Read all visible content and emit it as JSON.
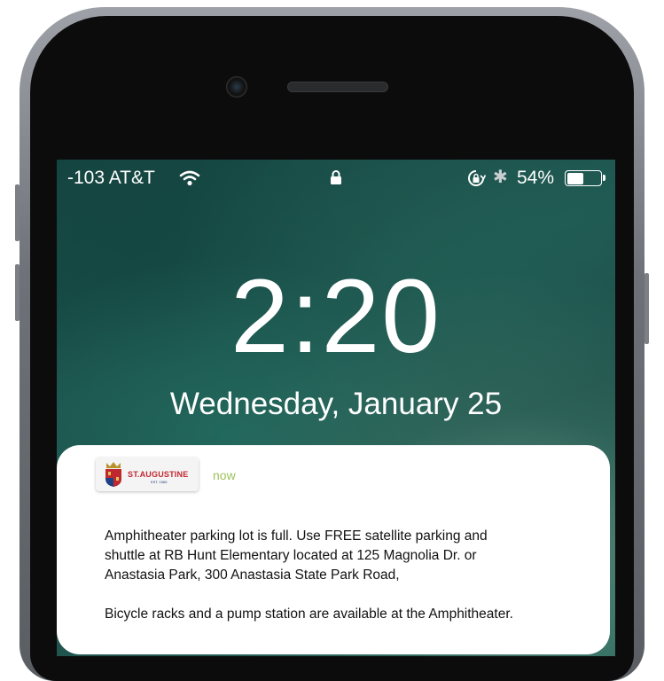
{
  "status_bar": {
    "carrier": "-103 AT&T",
    "battery_percent": "54%",
    "battery_level": 0.54,
    "icons": [
      "wifi-icon",
      "lock-icon",
      "rotation-lock-icon",
      "bluetooth-icon",
      "battery-icon"
    ]
  },
  "lock_screen": {
    "time": "2:20",
    "date": "Wednesday, January 25"
  },
  "notification": {
    "app_logo_text": "ST.AUGUSTINE",
    "app_logo_subtext": "EST. 1565",
    "timestamp": "now",
    "timestamp_color": "#9ec25a",
    "message_line_1": "Amphitheater parking lot is full. Use FREE satellite parking and",
    "message_line_2": "shuttle at RB Hunt Elementary located at 125 Magnolia Dr. or",
    "message_line_3": "Anastasia Park, 300 Anastasia State Park Road,",
    "message_line_4": "Bicycle racks and a pump station are available at the Amphitheater."
  }
}
